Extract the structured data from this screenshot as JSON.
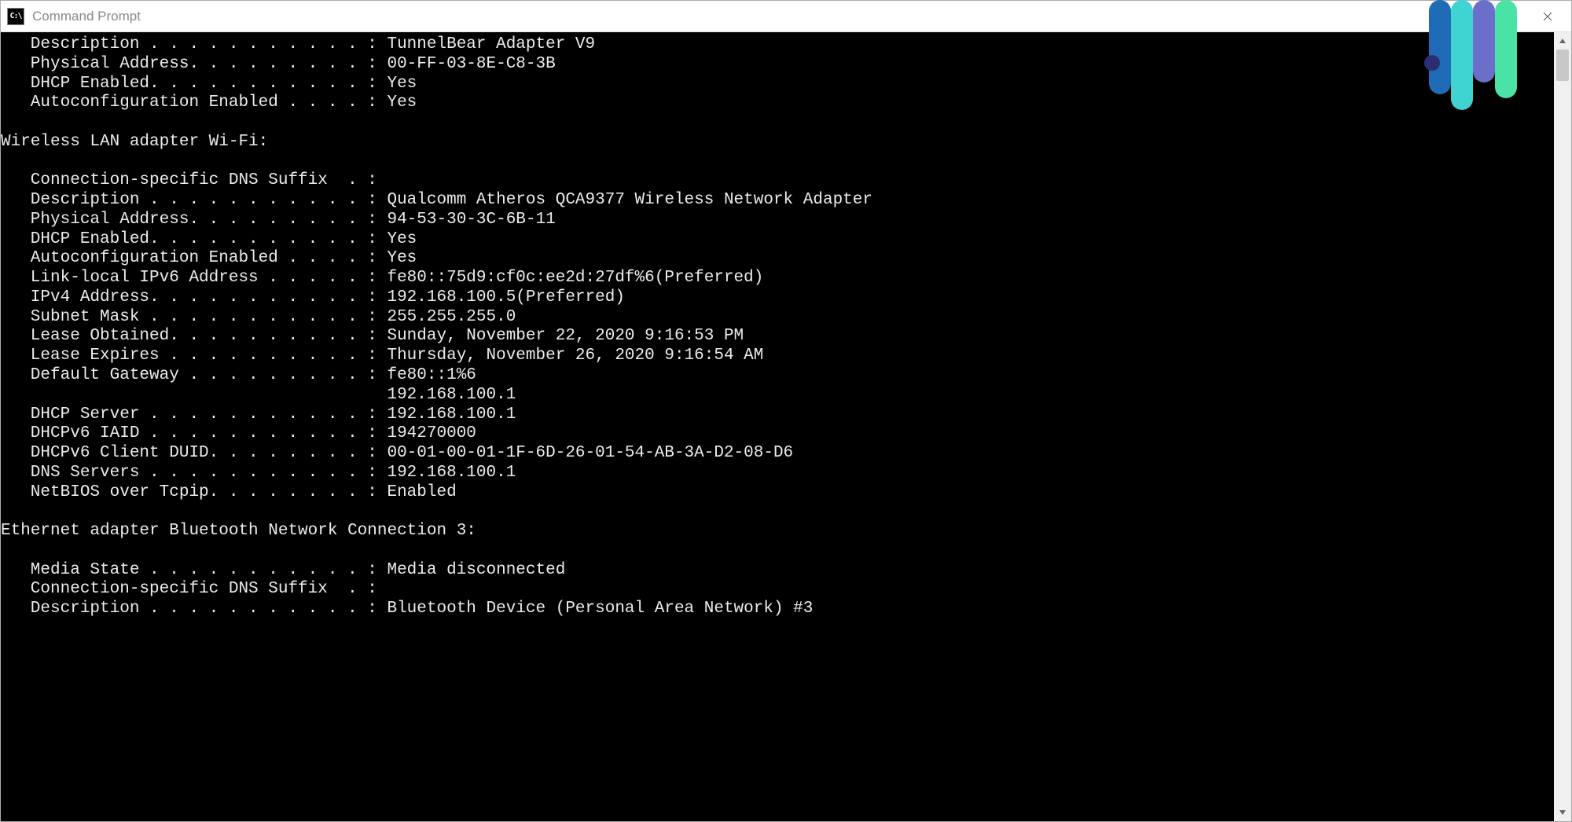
{
  "window": {
    "title": "Command Prompt",
    "icon_text": "C:\\"
  },
  "terminal": {
    "lines": [
      "   Description . . . . . . . . . . . : TunnelBear Adapter V9",
      "   Physical Address. . . . . . . . . : 00-FF-03-8E-C8-3B",
      "   DHCP Enabled. . . . . . . . . . . : Yes",
      "   Autoconfiguration Enabled . . . . : Yes",
      "",
      "Wireless LAN adapter Wi-Fi:",
      "",
      "   Connection-specific DNS Suffix  . :",
      "   Description . . . . . . . . . . . : Qualcomm Atheros QCA9377 Wireless Network Adapter",
      "   Physical Address. . . . . . . . . : 94-53-30-3C-6B-11",
      "   DHCP Enabled. . . . . . . . . . . : Yes",
      "   Autoconfiguration Enabled . . . . : Yes",
      "   Link-local IPv6 Address . . . . . : fe80::75d9:cf0c:ee2d:27df%6(Preferred)",
      "   IPv4 Address. . . . . . . . . . . : 192.168.100.5(Preferred)",
      "   Subnet Mask . . . . . . . . . . . : 255.255.255.0",
      "   Lease Obtained. . . . . . . . . . : Sunday, November 22, 2020 9:16:53 PM",
      "   Lease Expires . . . . . . . . . . : Thursday, November 26, 2020 9:16:54 AM",
      "   Default Gateway . . . . . . . . . : fe80::1%6",
      "                                       192.168.100.1",
      "   DHCP Server . . . . . . . . . . . : 192.168.100.1",
      "   DHCPv6 IAID . . . . . . . . . . . : 194270000",
      "   DHCPv6 Client DUID. . . . . . . . : 00-01-00-01-1F-6D-26-01-54-AB-3A-D2-08-D6",
      "   DNS Servers . . . . . . . . . . . : 192.168.100.1",
      "   NetBIOS over Tcpip. . . . . . . . : Enabled",
      "",
      "Ethernet adapter Bluetooth Network Connection 3:",
      "",
      "   Media State . . . . . . . . . . . : Media disconnected",
      "   Connection-specific DNS Suffix  . :",
      "   Description . . . . . . . . . . . : Bluetooth Device (Personal Area Network) #3"
    ]
  }
}
